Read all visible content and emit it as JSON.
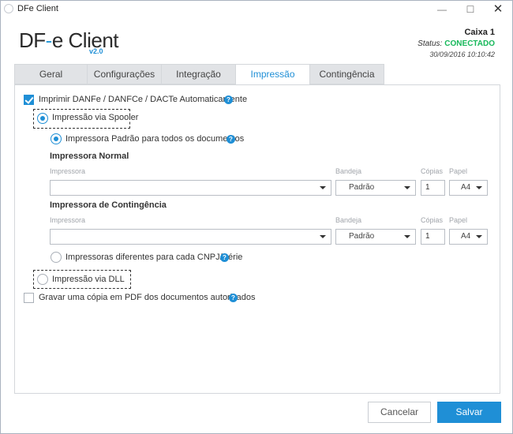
{
  "window": {
    "title": "DFe Client",
    "min_glyph": "—",
    "max_glyph": "☐",
    "close_glyph": "✕"
  },
  "header": {
    "logo_part1": "DF",
    "logo_dash": "-",
    "logo_part2": "e Client",
    "version": "v2.0",
    "caixa": "Caixa 1",
    "status_label": "Status:",
    "status_value": "CONECTADO",
    "datetime": "30/09/2016 10:10:42",
    "status_color": "#16b85a",
    "accent_color": "#1f8fd6"
  },
  "tabs": [
    {
      "label": "Geral",
      "active": false
    },
    {
      "label": "Configurações",
      "active": false
    },
    {
      "label": "Integração",
      "active": false
    },
    {
      "label": "Impressão",
      "active": true
    },
    {
      "label": "Contingência",
      "active": false
    }
  ],
  "impressao": {
    "auto_print": {
      "label": "Imprimir DANFe / DANFCe / DACTe Automaticamente",
      "checked": true
    },
    "spooler": {
      "label": "Impressão via Spooler",
      "selected": true
    },
    "default_printer": {
      "label": "Impressora Padrão para todos os documentos",
      "selected": true
    },
    "normal": {
      "title": "Impressora Normal",
      "printer_label": "Impressora",
      "printer_value": "",
      "tray_label": "Bandeja",
      "tray_value": "Padrão",
      "copies_label": "Cópias",
      "copies_value": "1",
      "paper_label": "Papel",
      "paper_value": "A4"
    },
    "contingencia": {
      "title": "Impressora de Contingência",
      "printer_label": "Impressora",
      "printer_value": "",
      "tray_label": "Bandeja",
      "tray_value": "Padrão",
      "copies_label": "Cópias",
      "copies_value": "1",
      "paper_label": "Papel",
      "paper_value": "A4"
    },
    "per_cnpj": {
      "label": "Impressoras diferentes para cada CNPJ/Série",
      "selected": false
    },
    "dll": {
      "label": "Impressão via DLL",
      "selected": false
    },
    "pdf_copy": {
      "label": "Gravar uma cópia em PDF dos documentos autorizados",
      "checked": false
    },
    "help_glyph": "?"
  },
  "footer": {
    "cancel_label": "Cancelar",
    "save_label": "Salvar"
  }
}
